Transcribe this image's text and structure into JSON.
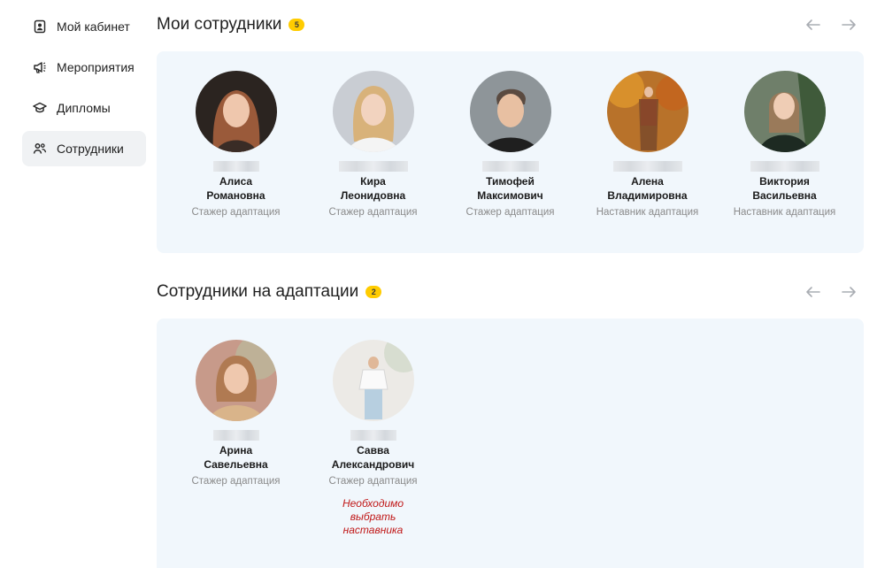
{
  "sidebar": {
    "items": [
      {
        "label": "Мой кабинет",
        "icon": "profile-card-icon",
        "active": false
      },
      {
        "label": "Мероприятия",
        "icon": "megaphone-icon",
        "active": false
      },
      {
        "label": "Дипломы",
        "icon": "graduation-cap-icon",
        "active": false
      },
      {
        "label": "Сотрудники",
        "icon": "people-icon",
        "active": true
      }
    ]
  },
  "my_employees": {
    "title": "Мои сотрудники",
    "count": "5",
    "cards": [
      {
        "name_line1": "Алиса",
        "name_line2": "Романовна",
        "role": "Стажер адаптация"
      },
      {
        "name_line1": "Кира",
        "name_line2": "Леонидовна",
        "role": "Стажер адаптация"
      },
      {
        "name_line1": "Тимофей",
        "name_line2": "Максимович",
        "role": "Стажер адаптация"
      },
      {
        "name_line1": "Алена",
        "name_line2": "Владимировна",
        "role": "Наставник адаптация"
      },
      {
        "name_line1": "Виктория",
        "name_line2": "Васильевна",
        "role": "Наставник адаптация"
      }
    ]
  },
  "adaptation_employees": {
    "title": "Сотрудники на адаптации",
    "count": "2",
    "cards": [
      {
        "name_line1": "Арина",
        "name_line2": "Савельевна",
        "role": "Стажер адаптация"
      },
      {
        "name_line1": "Савва",
        "name_line2": "Александрович",
        "role": "Стажер адаптация",
        "warning": "Необходимо выбрать наставника"
      }
    ]
  },
  "colors": {
    "accent_badge": "#ffcc00",
    "panel_bg": "#f1f7fc",
    "warning_text": "#c01818"
  }
}
